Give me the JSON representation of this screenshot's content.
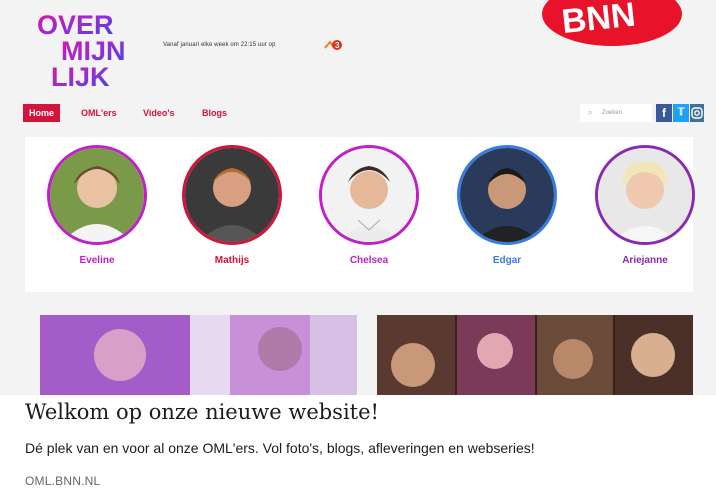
{
  "header": {
    "logo_lines": [
      "OVER",
      "MIJN",
      "LIJK"
    ],
    "tagline": "Vanaf januari elke week om 22:15 uur op",
    "broadcaster_logo": "BNN"
  },
  "nav": {
    "items": [
      "Home",
      "OML'ers",
      "Video's",
      "Blogs"
    ],
    "active": "Home"
  },
  "search": {
    "placeholder": "Zoeken",
    "icon": "search-icon"
  },
  "social": [
    "facebook-icon",
    "twitter-icon",
    "instagram-icon"
  ],
  "profiles": [
    {
      "name": "Eveline",
      "color": "#c020c8"
    },
    {
      "name": "Mathijs",
      "color": "#d0153a"
    },
    {
      "name": "Chelsea",
      "color": "#c020c8"
    },
    {
      "name": "Edgar",
      "color": "#3a7be0"
    },
    {
      "name": "Ariejanne",
      "color": "#8a2ab0"
    }
  ],
  "link_card": {
    "title": "Welkom op onze nieuwe website!",
    "description": "Dé plek van en voor al onze OML'ers. Vol foto's, blogs, afleveringen en webseries!",
    "domain": "OML.BNN.NL"
  }
}
